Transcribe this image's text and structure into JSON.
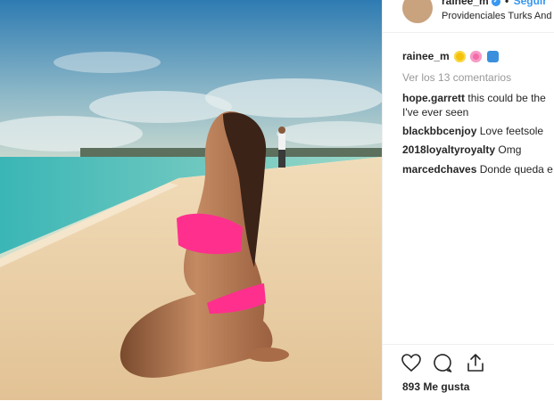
{
  "post": {
    "header": {
      "username": "rainee_m",
      "verified_icon": "verified-badge-icon",
      "separator": "•",
      "follow_label": "Seguir",
      "location": "Providenciales Turks And C"
    },
    "caption": {
      "username": "rainee_m",
      "emojis": [
        "sun-flower-emoji",
        "pink-flower-emoji",
        "wave-emoji"
      ]
    },
    "view_comments": "Ver los 13 comentarios",
    "comments": [
      {
        "username": "hope.garrett",
        "text_line1": "this could be the",
        "text_line2": "I've ever seen"
      },
      {
        "username": "blackbbcenjoy",
        "text": "Love feetsole"
      },
      {
        "username": "2018loyaltyroyalty",
        "text": "Omg"
      },
      {
        "username": "marcedchaves",
        "text": "Donde queda e"
      }
    ],
    "likes": "893 Me gusta"
  },
  "colors": {
    "link": "#3897f0",
    "muted": "#999999",
    "text": "#262626",
    "bikini": "#ff2f8e"
  }
}
